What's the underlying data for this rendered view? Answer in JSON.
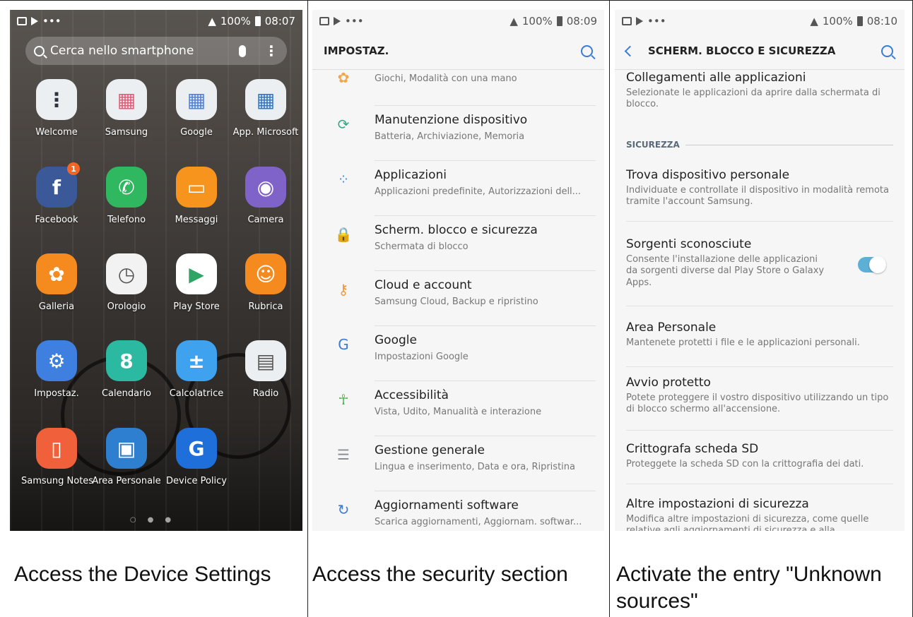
{
  "panel1": {
    "status": {
      "battery": "100%",
      "time": "08:07"
    },
    "search_placeholder": "Cerca nello smartphone",
    "apps": [
      {
        "label": "Welcome",
        "icon": "welcome-icon",
        "color": "#eceff1"
      },
      {
        "label": "Samsung",
        "icon": "samsung-folder-icon",
        "color": "#eceff1"
      },
      {
        "label": "Google",
        "icon": "google-folder-icon",
        "color": "#eceff1"
      },
      {
        "label": "App. Microsoft",
        "icon": "microsoft-folder-icon",
        "color": "#eceff1"
      },
      {
        "label": "Facebook",
        "icon": "facebook-icon",
        "color": "#3b5998",
        "badge": "1"
      },
      {
        "label": "Telefono",
        "icon": "phone-icon",
        "color": "#2fb860"
      },
      {
        "label": "Messaggi",
        "icon": "messages-icon",
        "color": "#f7941d"
      },
      {
        "label": "Camera",
        "icon": "camera-icon",
        "color": "#7f63c9"
      },
      {
        "label": "Galleria",
        "icon": "gallery-icon",
        "color": "#f58a1f"
      },
      {
        "label": "Orologio",
        "icon": "clock-icon",
        "color": "#f2f2f2"
      },
      {
        "label": "Play Store",
        "icon": "play-store-icon",
        "color": "#ffffff"
      },
      {
        "label": "Rubrica",
        "icon": "contacts-icon",
        "color": "#f58a1f"
      },
      {
        "label": "Impostaz.",
        "icon": "settings-icon",
        "color": "#3f7fe0"
      },
      {
        "label": "Calendario",
        "icon": "calendar-icon",
        "color": "#2bb9a2"
      },
      {
        "label": "Calcolatrice",
        "icon": "calculator-icon",
        "color": "#3fa2ef"
      },
      {
        "label": "Radio",
        "icon": "radio-icon",
        "color": "#eceff1"
      },
      {
        "label": "Samsung Notes",
        "icon": "notes-icon",
        "color": "#f0603a"
      },
      {
        "label": "Area Personale",
        "icon": "secure-folder-icon",
        "color": "#2f7fd0"
      },
      {
        "label": "Device Policy",
        "icon": "device-policy-icon",
        "color": "#1e6fd9"
      }
    ]
  },
  "panel2": {
    "status": {
      "battery": "100%",
      "time": "08:09"
    },
    "title": "IMPOSTAZ.",
    "partial_row": "Giochi, Modalità con una mano",
    "rows": [
      {
        "title": "Manutenzione dispositivo",
        "sub": "Batteria, Archiviazione, Memoria",
        "icon": "device-maintenance-icon"
      },
      {
        "title": "Applicazioni",
        "sub": "Applicazioni predefinite, Autorizzazioni dell...",
        "icon": "apps-icon"
      },
      {
        "title": "Scherm. blocco e sicurezza",
        "sub": "Schermata di blocco",
        "icon": "lock-icon"
      },
      {
        "title": "Cloud e account",
        "sub": "Samsung Cloud, Backup e ripristino",
        "icon": "key-icon"
      },
      {
        "title": "Google",
        "sub": "Impostazioni Google",
        "icon": "google-icon"
      },
      {
        "title": "Accessibilità",
        "sub": "Vista, Udito, Manualità e interazione",
        "icon": "accessibility-icon"
      },
      {
        "title": "Gestione generale",
        "sub": "Lingua e inserimento, Data e ora, Ripristina",
        "icon": "general-management-icon"
      },
      {
        "title": "Aggiornamenti software",
        "sub": "Scarica aggiornamenti, Aggiornam. softwar...",
        "icon": "software-update-icon"
      }
    ]
  },
  "panel3": {
    "status": {
      "battery": "100%",
      "time": "08:10"
    },
    "title": "SCHERM. BLOCCO E SICUREZZA",
    "section": "SICUREZZA",
    "rows": [
      {
        "title": "Collegamenti alle applicazioni",
        "sub": "Selezionate le applicazioni da aprire dalla schermata di blocco."
      },
      {
        "title": "Trova dispositivo personale",
        "sub": "Individuate e controllate il dispositivo in modalità remota tramite l'account Samsung."
      },
      {
        "title": "Sorgenti sconosciute",
        "sub": "Consente l'installazione delle applicazioni da sorgenti diverse dal Play Store o Galaxy Apps.",
        "toggle_on": true
      },
      {
        "title": "Area Personale",
        "sub": "Mantenete protetti i file e le applicazioni personali."
      },
      {
        "title": "Avvio protetto",
        "sub": "Potete proteggere il vostro dispositivo utilizzando un tipo di blocco schermo all'accensione."
      },
      {
        "title": "Crittografa scheda SD",
        "sub": "Proteggete la scheda SD con la crittografia dei dati."
      },
      {
        "title": "Altre impostazioni di sicurezza",
        "sub": "Modifica altre impostazioni di sicurezza, come quelle relative agli aggiornamenti di sicurezza e alla"
      }
    ]
  },
  "captions": [
    "Access the Device Settings",
    "Access the security section",
    "Activate the entry \"Unknown sources\""
  ]
}
